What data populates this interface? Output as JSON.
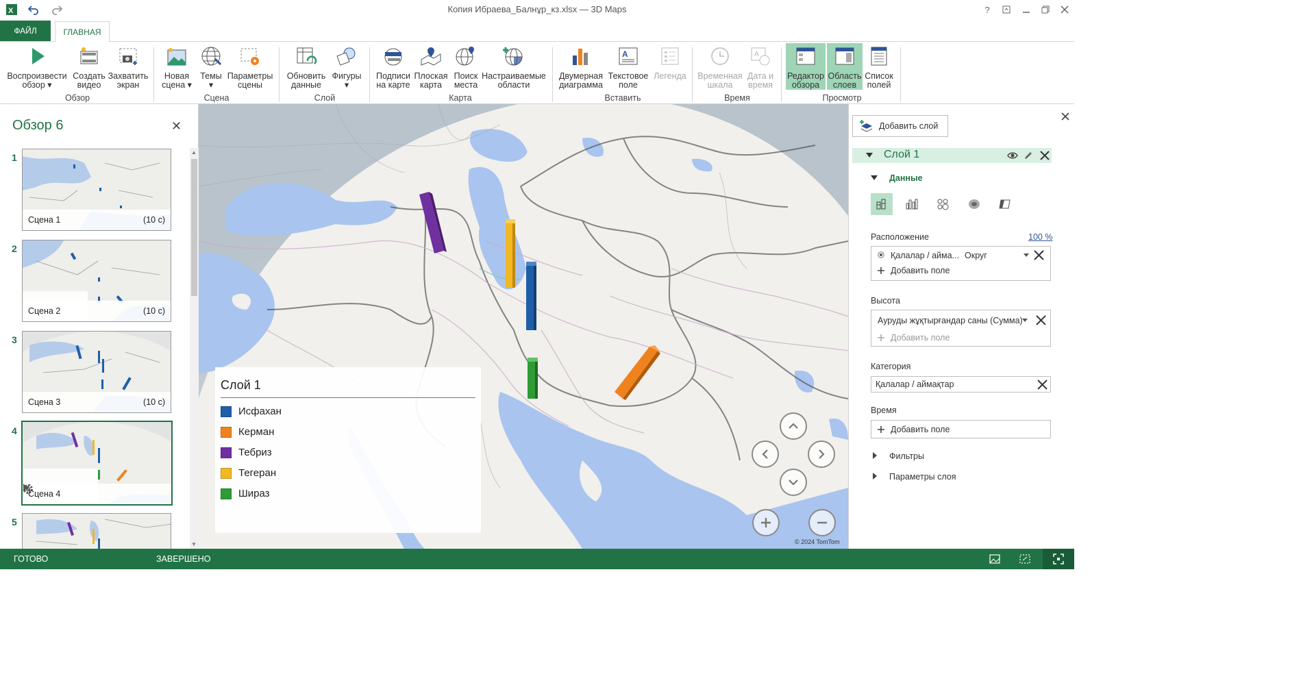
{
  "window": {
    "title": "Копия Ибраева_Балнұр_кз.xlsx — 3D Maps"
  },
  "tabs": {
    "file": "ФАЙЛ",
    "home": "ГЛАВНАЯ"
  },
  "ribbon": {
    "play_tour": [
      "Воспроизвести",
      "обзор ▾"
    ],
    "create_video": [
      "Создать",
      "видео"
    ],
    "capture_screen": [
      "Захватить",
      "экран"
    ],
    "new_scene": [
      "Новая",
      "сцена ▾"
    ],
    "themes": [
      "Темы",
      "▾"
    ],
    "scene_options": [
      "Параметры",
      "сцены"
    ],
    "refresh_data": [
      "Обновить",
      "данные"
    ],
    "shapes": [
      "Фигуры",
      "▾"
    ],
    "map_labels": [
      "Подписи",
      "на карте"
    ],
    "flat_map": [
      "Плоская",
      "карта"
    ],
    "find_location": [
      "Поиск",
      "места"
    ],
    "custom_regions": [
      "Настраиваемые",
      "области"
    ],
    "chart_2d": [
      "Двумерная",
      "диаграмма"
    ],
    "text_box": [
      "Текстовое",
      "поле"
    ],
    "legend": [
      "Легенда",
      ""
    ],
    "timeline": [
      "Временная",
      "шкала"
    ],
    "date_time": [
      "Дата и",
      "время"
    ],
    "tour_editor": [
      "Редактор",
      "обзора"
    ],
    "layer_pane": [
      "Область",
      "слоев"
    ],
    "field_list": [
      "Список",
      "полей"
    ],
    "groups": {
      "tour": "Обзор",
      "scene": "Сцена",
      "layer": "Слой",
      "map": "Карта",
      "insert": "Вставить",
      "time": "Время",
      "view": "Просмотр"
    }
  },
  "tour": {
    "title": "Обзор 6",
    "scenes": [
      {
        "num": "1",
        "name": "Сцена 1",
        "duration": "(10 с)"
      },
      {
        "num": "2",
        "name": "Сцена 2",
        "duration": "(10 с)"
      },
      {
        "num": "3",
        "name": "Сцена 3",
        "duration": "(10 с)"
      },
      {
        "num": "4",
        "name": "Сцена 4",
        "duration": ""
      },
      {
        "num": "5",
        "name": "",
        "duration": ""
      }
    ]
  },
  "map": {
    "legend_title": "Слой 1",
    "legend_items": [
      {
        "label": "Исфахан",
        "color": "#1f5fa8"
      },
      {
        "label": "Керман",
        "color": "#f0821e"
      },
      {
        "label": "Тебриз",
        "color": "#7030a0"
      },
      {
        "label": "Тегеран",
        "color": "#f2b824"
      },
      {
        "label": "Шираз",
        "color": "#2e9b34"
      }
    ],
    "copyright": "© 2024 TomTom"
  },
  "layer_pane": {
    "add_layer": "Добавить слой",
    "layer_name": "Слой 1",
    "data_section": "Данные",
    "location_label": "Расположение",
    "location_percent": "100 %",
    "location_field": "Қалалар / айма...",
    "location_type": "Округ",
    "add_field": "Добавить поле",
    "height_label": "Высота",
    "height_field": "Ауруды жұқтырғандар саны (Сумма)",
    "category_label": "Категория",
    "category_field": "Қалалар / аймақтар",
    "time_label": "Время",
    "filters": "Фильтры",
    "layer_options": "Параметры слоя"
  },
  "status": {
    "ready": "ГОТОВО",
    "done": "ЗАВЕРШЕНО"
  },
  "colors": {
    "accent": "#217346",
    "water": "#a9c4ee",
    "land": "#f1f0ec",
    "active_button": "#9fd5b7"
  }
}
